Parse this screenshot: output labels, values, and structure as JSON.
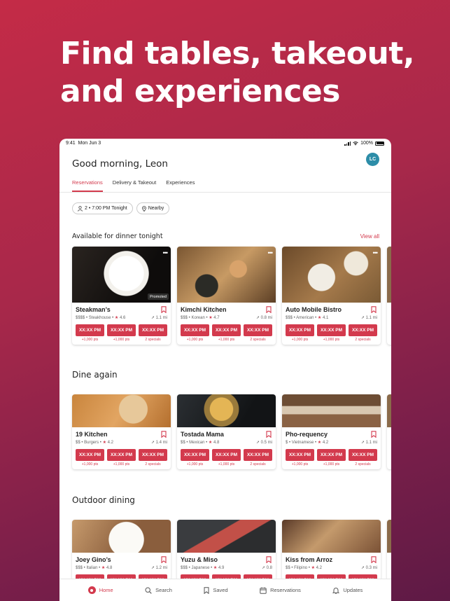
{
  "headline": {
    "line1": "Find tables, takeout,",
    "line2": "and experiences"
  },
  "status": {
    "time": "9:41",
    "date": "Mon Jun 3",
    "battery": "100%"
  },
  "greeting": "Good morning, Leon",
  "avatar": "LC",
  "tabs": [
    "Reservations",
    "Delivery & Takeout",
    "Experiences"
  ],
  "chips": {
    "party": "2 • 7:00 PM Tonight",
    "location": "Nearby"
  },
  "sections": {
    "available": {
      "title": "Available for dinner tonight",
      "view_all": "View all"
    },
    "dine_again": {
      "title": "Dine again"
    },
    "outdoor": {
      "title": "Outdoor dining"
    }
  },
  "slot_label": "XX:XX PM",
  "slot_subs": [
    "+1,000 pts",
    "+1,000 pts",
    "2 specials"
  ],
  "promoted": "Promoted",
  "cards_available": [
    {
      "name": "Steakman’s",
      "price": "$$$$",
      "cuisine": "Steakhouse",
      "rating": "4.6",
      "distance": "1.1 mi"
    },
    {
      "name": "Kimchi Kitchen",
      "price": "$$$",
      "cuisine": "Korean",
      "rating": "4.7",
      "distance": "0.8 mi"
    },
    {
      "name": "Auto Mobile Bistro",
      "price": "$$$",
      "cuisine": "American",
      "rating": "4.1",
      "distance": "1.1 mi"
    }
  ],
  "cards_dine_again": [
    {
      "name": "19 Kitchen",
      "price": "$$",
      "cuisine": "Burgers",
      "rating": "4.2",
      "distance": "1.4 mi"
    },
    {
      "name": "Tostada Mama",
      "price": "$$",
      "cuisine": "Mexican",
      "rating": "4.8",
      "distance": "0.5 mi"
    },
    {
      "name": "Pho-requency",
      "price": "$",
      "cuisine": "Vietnamese",
      "rating": "4.2",
      "distance": "1.1 mi"
    }
  ],
  "cards_outdoor": [
    {
      "name": "Joey Gino’s",
      "price": "$$$",
      "cuisine": "Italian",
      "rating": "4.8",
      "distance": "1.2 mi"
    },
    {
      "name": "Yuzu & Miso",
      "price": "$$$",
      "cuisine": "Japanese",
      "rating": "4.9",
      "distance": "0.8"
    },
    {
      "name": "Kiss from Arroz",
      "price": "$$",
      "cuisine": "Filipino",
      "rating": "4.2",
      "distance": "0.3 mi"
    }
  ],
  "tabbar": [
    "Home",
    "Search",
    "Saved",
    "Reservations",
    "Updates"
  ],
  "colors": {
    "accent": "#d33a4d",
    "avatar": "#2d8da8"
  }
}
